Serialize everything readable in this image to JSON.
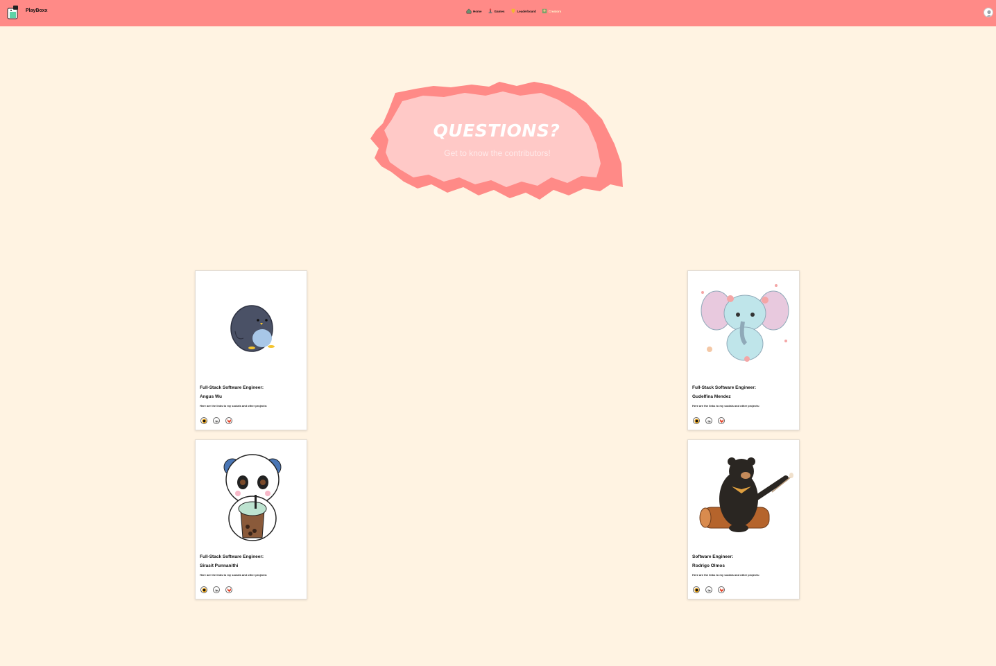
{
  "nav": {
    "brand": "PlayBoxx",
    "links": [
      {
        "label": "Home",
        "icon": "home-icon"
      },
      {
        "label": "Games",
        "icon": "games-icon"
      },
      {
        "label": "Leaderboard",
        "icon": "trophy-icon"
      },
      {
        "label": "Creators",
        "icon": "creators-icon",
        "active": true
      }
    ]
  },
  "hero": {
    "title": "QUESTIONS?",
    "subtitle": "Get to know the contributors!"
  },
  "contributors": [
    {
      "role": "Full-Stack Software Engineer:",
      "name": "Angus Wu",
      "description": "Here are the links to my socials and other projects:",
      "image": "penguin",
      "socials": [
        "github-icon",
        "linkedin-icon",
        "gitlab-icon"
      ]
    },
    {
      "role": "Full-Stack Software Engineer:",
      "name": "Gudelfina Mendez",
      "description": "Here are the links to my socials and other projects:",
      "image": "elephant",
      "socials": [
        "github-icon",
        "linkedin-icon",
        "gitlab-icon"
      ]
    },
    {
      "role": "Full-Stack Software Engineer:",
      "name": "Sirasit Punnanithi",
      "description": "Here are the links to my socials and other projects:",
      "image": "panda",
      "socials": [
        "github-icon",
        "linkedin-icon",
        "gitlab-icon"
      ]
    },
    {
      "role": "Software Engineer:",
      "name": "Rodrigo Olmos",
      "description": "Here are the links to my socials and other projects:",
      "image": "bear",
      "socials": [
        "github-icon",
        "linkedin-icon",
        "gitlab-icon"
      ]
    }
  ],
  "colors": {
    "navbar": "#ff8a87",
    "background": "#fff3e2",
    "brush": "#ff8a87",
    "brush_inner": "#ffc9c7"
  }
}
